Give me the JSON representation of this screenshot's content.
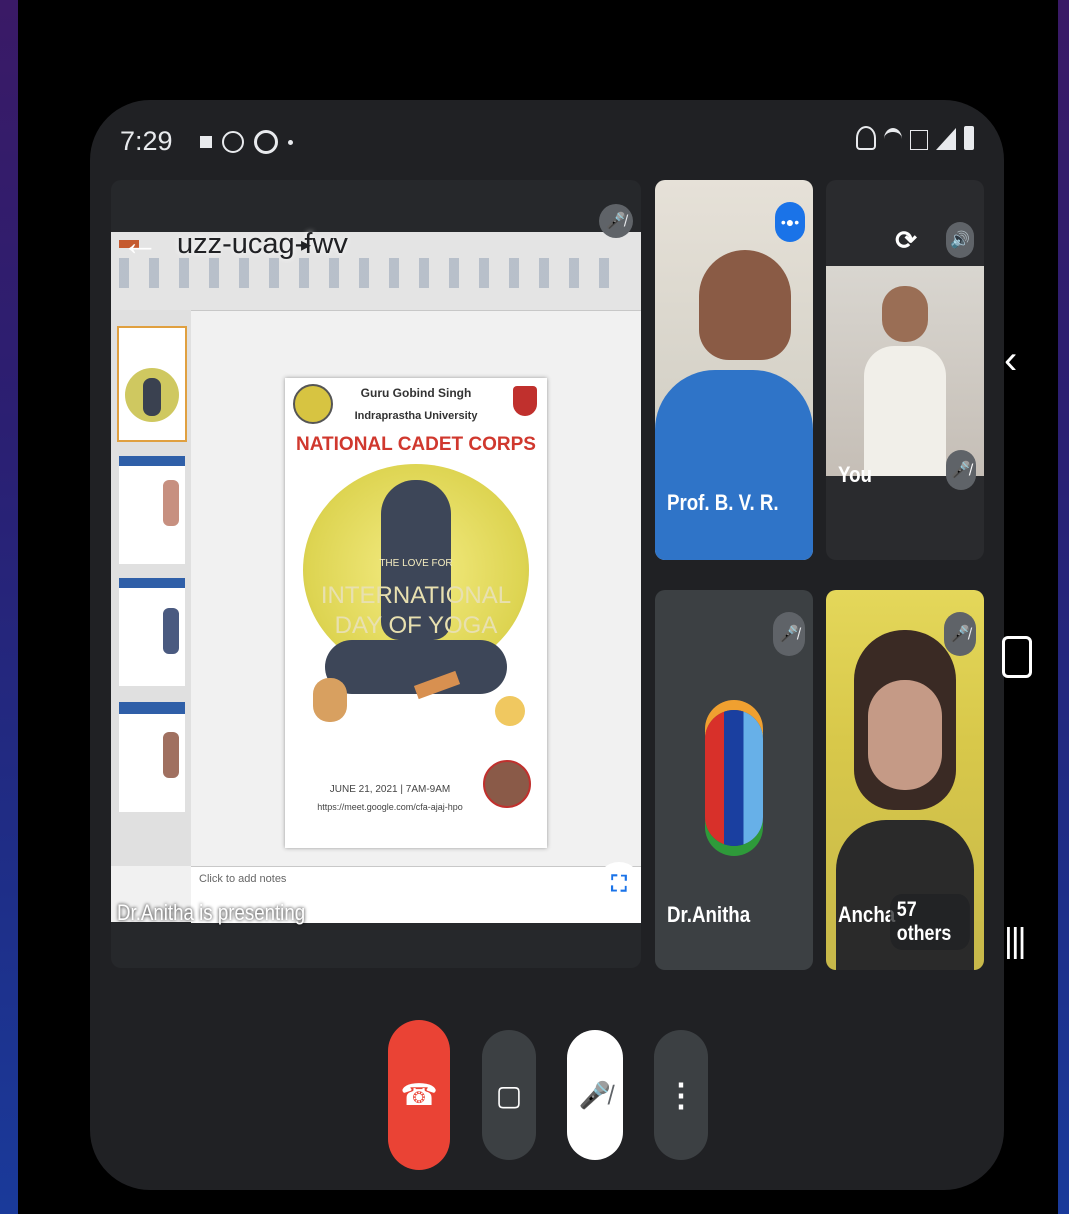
{
  "status_bar": {
    "time": "7:29",
    "left_icons": [
      "media-icon",
      "whatsapp-icon",
      "settings-icon"
    ],
    "right_icons": [
      "alarm-icon",
      "wifi-icon",
      "volte-icon",
      "signal-icon",
      "battery-icon"
    ]
  },
  "meeting": {
    "code": "uzz-ucag-fwv",
    "presenting_text": "Dr.Anitha is presenting"
  },
  "slide": {
    "university_line1": "Guru Gobind Singh",
    "university_line2": "Indraprastha University",
    "heading": "NATIONAL CADET CORPS",
    "tagline": "THE LOVE FOR",
    "event_line1": "INTERNATIONAL",
    "event_line2": "DAY OF YOGA",
    "date_time": "JUNE 21, 2021 | 7AM-9AM",
    "link": "https://meet.google.com/cfa-ajaj-hpo",
    "notes_placeholder": "Click to add notes"
  },
  "participants": [
    {
      "name": "Prof. B. V. R."
    },
    {
      "name": "You"
    },
    {
      "name": "Dr.Anitha"
    },
    {
      "name": "Ancha"
    }
  ],
  "others_count": "57 others",
  "colors": {
    "end_call": "#ea4335",
    "tile_bg": "#3c4043",
    "speaking_blue": "#1a73e8"
  }
}
